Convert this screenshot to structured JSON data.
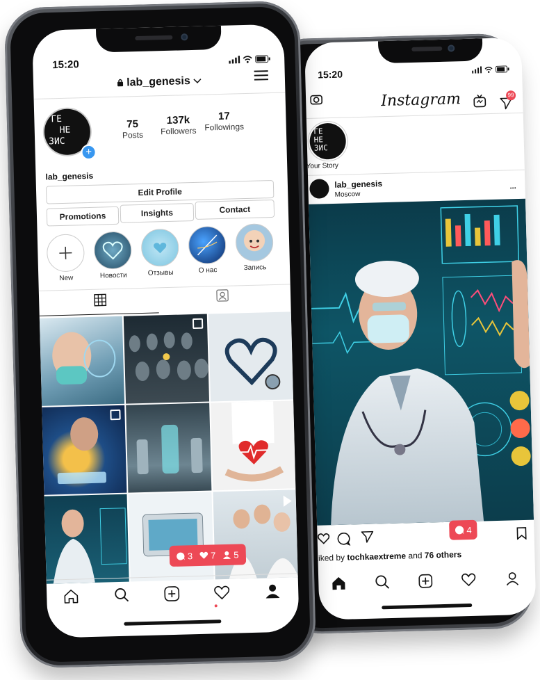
{
  "profile_screen": {
    "status_time": "15:20",
    "username": "lab_genesis",
    "stats": [
      {
        "value": "75",
        "label": "Posts"
      },
      {
        "value": "137k",
        "label": "Followers"
      },
      {
        "value": "17",
        "label": "Followings"
      }
    ],
    "bio_name": "lab_genesis",
    "avatar_letters": [
      "ГЕ",
      "НЕ",
      "ЗИС"
    ],
    "buttons": {
      "edit_profile": "Edit Profile",
      "promotions": "Promotions",
      "insights": "Insights",
      "contact": "Contact"
    },
    "highlights": [
      {
        "label": "New"
      },
      {
        "label": "Новости"
      },
      {
        "label": "Отзывы"
      },
      {
        "label": "О нас"
      },
      {
        "label": "Запись"
      }
    ],
    "notifications": {
      "comments": "3",
      "likes": "7",
      "follows": "5"
    },
    "colors": {
      "accent_blue": "#3897f0",
      "notif_red": "#ed4956"
    }
  },
  "feed_screen": {
    "status_time": "15:20",
    "logo_text": "Instagram",
    "direct_badge": "99",
    "story_label": "Your Story",
    "post": {
      "username": "lab_genesis",
      "location": "Moscow",
      "more": "...",
      "liked_prefix": "Liked by ",
      "liked_user": "tochkaextreme",
      "liked_mid": " and ",
      "liked_others": "76 others"
    },
    "comment_badge": "4"
  }
}
